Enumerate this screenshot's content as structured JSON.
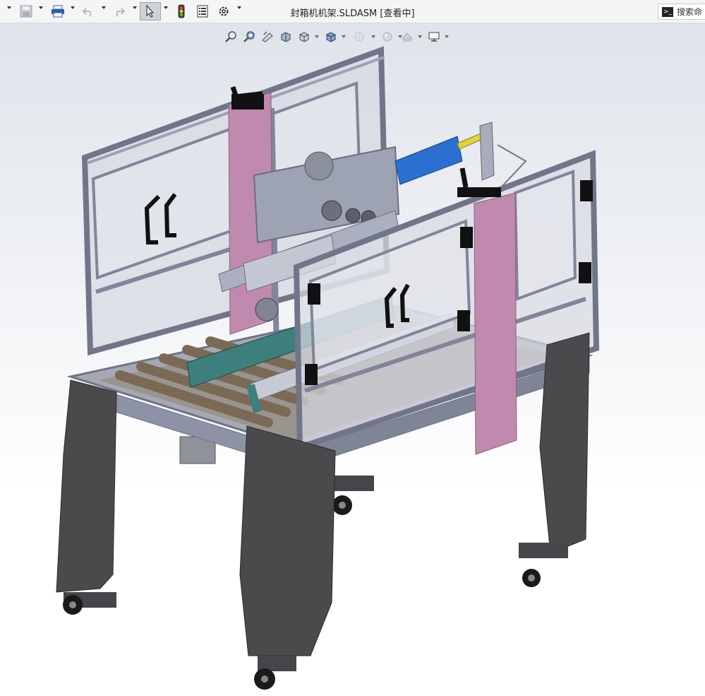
{
  "window": {
    "title": "封箱机机架.SLDASM [查看中]"
  },
  "toolbar": {
    "items": [
      {
        "name": "dropdown-caret",
        "icon": "chevron-down-icon"
      },
      {
        "name": "save",
        "icon": "save-icon"
      },
      {
        "name": "print",
        "icon": "printer-icon"
      },
      {
        "name": "undo",
        "icon": "undo-icon"
      },
      {
        "name": "redo",
        "icon": "redo-icon"
      },
      {
        "name": "select",
        "icon": "cursor-icon",
        "active": true
      },
      {
        "name": "rebuild",
        "icon": "traffic-light-icon"
      },
      {
        "name": "file-properties",
        "icon": "properties-icon"
      },
      {
        "name": "options",
        "icon": "gear-icon"
      }
    ]
  },
  "search": {
    "placeholder": "搜索命",
    "icon": "command-prompt-icon"
  },
  "heads_up_toolbar": {
    "items": [
      {
        "name": "zoom-to-fit",
        "icon": "zoom-fit-icon"
      },
      {
        "name": "zoom-to-area",
        "icon": "zoom-area-icon"
      },
      {
        "name": "previous-view",
        "icon": "previous-view-icon"
      },
      {
        "name": "section-view",
        "icon": "section-view-icon"
      },
      {
        "name": "view-orientation",
        "icon": "view-orientation-icon"
      },
      {
        "name": "display-style",
        "icon": "display-style-icon"
      },
      {
        "name": "hide-show-items",
        "icon": "hide-show-icon"
      },
      {
        "name": "edit-appearance",
        "icon": "appearance-icon"
      },
      {
        "name": "apply-scene",
        "icon": "scene-icon"
      },
      {
        "name": "view-settings",
        "icon": "monitor-icon"
      }
    ]
  },
  "model": {
    "description_icon": "carton-sealer-frame-model",
    "colors": {
      "frame": "#8d92a6",
      "frame_dark": "#6f7486",
      "legs": "#4a4a4d",
      "glass": "#d8dbe2",
      "pink_column": "#c08aaf",
      "belt": "#3d7f7c",
      "cylinder": "#2b6fd1",
      "rod": "#e0d23a",
      "handle": "#111111",
      "wheel": "#1a1a1a"
    }
  }
}
